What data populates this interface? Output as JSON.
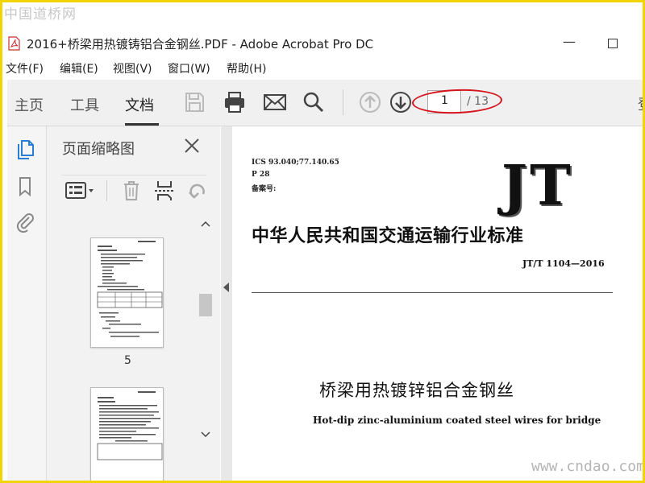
{
  "watermark": {
    "top": "中国道桥网",
    "bottom": "www.cndao.com"
  },
  "window": {
    "title": "2016+桥梁用热镀铸铝合金钢丝.PDF - Adobe Acrobat Pro DC"
  },
  "menu": [
    "文件(F)",
    "编辑(E)",
    "视图(V)",
    "窗口(W)",
    "帮助(H)"
  ],
  "tabs": [
    {
      "label": "主页",
      "active": false
    },
    {
      "label": "工具",
      "active": false
    },
    {
      "label": "文档",
      "active": true
    }
  ],
  "toolbar": {
    "icons": [
      "save-icon",
      "print-icon",
      "email-icon",
      "search-icon",
      "arrow-up-icon",
      "arrow-down-icon"
    ],
    "page_current": "1",
    "page_total": "/ 13",
    "cut_text": "登",
    "highlight_color": "#d6141d"
  },
  "thumbnails": {
    "title": "页面缩略图",
    "visible_page": "5"
  },
  "document": {
    "ics": "ICS 93.040;77.140.65",
    "p": "P 28",
    "record": "备案号:",
    "logo": "JT",
    "standard_cn": "中华人民共和国交通运输行业标准",
    "code": "JT/T 1104—2016",
    "title_cn": "桥梁用热镀锌铝合金钢丝",
    "title_en": "Hot-dip zinc-aluminium coated steel wires for bridge"
  },
  "colors": {
    "frame": "#f2d400",
    "toolbar_bg": "#f0f0f0",
    "accent_blue": "#2a7fd4"
  }
}
